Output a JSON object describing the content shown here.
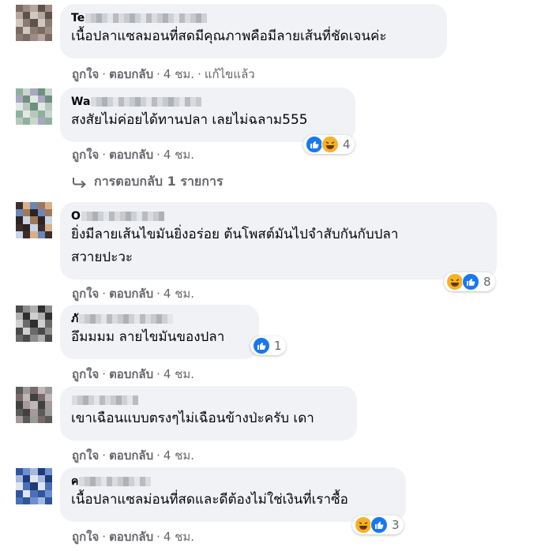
{
  "comments": [
    {
      "name_prefix": "Te",
      "text_lines": [
        "เนื้อปลาแซลมอนที่สดมีคุณภาพคือมีลายเส้นที่ชัดเจนค่ะ"
      ],
      "like": "ถูกใจ",
      "reply": "ตอบกลับ",
      "time": "4 ชม.",
      "edited": "แก้ไขแล้ว"
    },
    {
      "name_prefix": "Wa",
      "text_lines": [
        "สงสัยไม่ค่อยได้ทานปลา เลยไม่ฉลาม555"
      ],
      "like": "ถูกใจ",
      "reply": "ตอบกลับ",
      "time": "4 ชม.",
      "reactions": {
        "icons": [
          "like-icon",
          "haha-icon"
        ],
        "count": "4"
      },
      "replies_link": "การตอบกลับ 1 รายการ"
    },
    {
      "name_prefix": "O",
      "text_lines": [
        "ยิ่งมีลายเส้นไขมันยิ่งอร่อย ต้นโพสต์มันไปจำสับกันกับปลา",
        "สวายปะวะ"
      ],
      "like": "ถูกใจ",
      "reply": "ตอบกลับ",
      "time": "4 ชม.",
      "reactions": {
        "icons": [
          "haha-icon",
          "like-icon"
        ],
        "count": "8"
      }
    },
    {
      "name_prefix": "ภั",
      "text_lines": [
        "อึมมมม ลายไขมันของปลา"
      ],
      "like": "ถูกใจ",
      "reply": "ตอบกลับ",
      "time": "4 ชม.",
      "reactions": {
        "icons": [
          "like-icon"
        ],
        "count": "1"
      }
    },
    {
      "name_prefix": "",
      "text_lines": [
        "เขาเฉือนแบบตรงๆไม่เฉือนข้างป่ะครับ เดา"
      ],
      "like": "ถูกใจ",
      "reply": "ตอบกลับ",
      "time": "4 ชม."
    },
    {
      "name_prefix": "ค",
      "text_lines": [
        "เนื้อปลาแซลม่อนที่สดและดีต้องไม่ใช่เงินที่เราซื้อ"
      ],
      "like": "ถูกใจ",
      "reply": "ตอบกลับ",
      "time": "4 ชม.",
      "reactions": {
        "icons": [
          "haha-icon",
          "like-icon"
        ],
        "count": "3"
      }
    }
  ],
  "separator": "·",
  "colors": {
    "bubble": "#f0f2f5",
    "meta": "#65676b",
    "like_blue": "#1877f2",
    "haha_yellow": "#f7b125"
  }
}
